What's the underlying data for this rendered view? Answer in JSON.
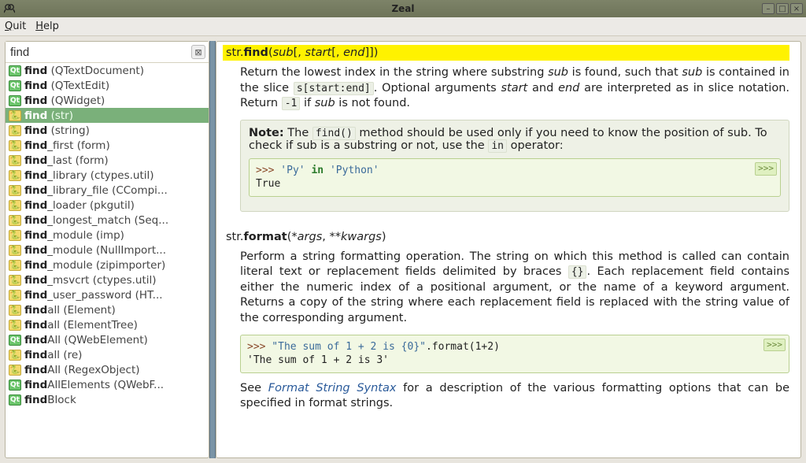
{
  "window": {
    "title": "Zeal"
  },
  "menubar": {
    "quit": "Quit",
    "help": "Help"
  },
  "search": {
    "value": "find"
  },
  "results": [
    {
      "icon": "qt",
      "func": "find",
      "ctx": " (QTextDocument)"
    },
    {
      "icon": "qt",
      "func": "find",
      "ctx": " (QTextEdit)"
    },
    {
      "icon": "qt",
      "func": "find",
      "ctx": " (QWidget)"
    },
    {
      "icon": "py",
      "func": "find",
      "ctx": " (str)",
      "selected": true
    },
    {
      "icon": "py",
      "func": "find",
      "ctx": " (string)"
    },
    {
      "icon": "py",
      "func": "find",
      "ctx": "_first (form)"
    },
    {
      "icon": "py",
      "func": "find",
      "ctx": "_last (form)"
    },
    {
      "icon": "py",
      "func": "find",
      "ctx": "_library (ctypes.util)"
    },
    {
      "icon": "py",
      "func": "find",
      "ctx": "_library_file (CCompi..."
    },
    {
      "icon": "py",
      "func": "find",
      "ctx": "_loader (pkgutil)"
    },
    {
      "icon": "py",
      "func": "find",
      "ctx": "_longest_match (Seq..."
    },
    {
      "icon": "py",
      "func": "find",
      "ctx": "_module (imp)"
    },
    {
      "icon": "py",
      "func": "find",
      "ctx": "_module (NullImport..."
    },
    {
      "icon": "py",
      "func": "find",
      "ctx": "_module (zipimporter)"
    },
    {
      "icon": "py",
      "func": "find",
      "ctx": "_msvcrt (ctypes.util)"
    },
    {
      "icon": "py",
      "func": "find",
      "ctx": "_user_password (HT..."
    },
    {
      "icon": "py",
      "func": "find",
      "ctx": "all (Element)"
    },
    {
      "icon": "py",
      "func": "find",
      "ctx": "all (ElementTree)"
    },
    {
      "icon": "qt",
      "func": "find",
      "ctx": "All (QWebElement)"
    },
    {
      "icon": "py",
      "func": "find",
      "ctx": "all (re)"
    },
    {
      "icon": "py",
      "func": "find",
      "ctx": "All (RegexObject)"
    },
    {
      "icon": "qt",
      "func": "find",
      "ctx": "AllElements (QWebF..."
    },
    {
      "icon": "qt",
      "func": "find",
      "ctx": "Block"
    }
  ],
  "doc": {
    "find": {
      "cls": "str.",
      "name": "find",
      "args_open": "(",
      "a1": "sub",
      "a2_open": "[, ",
      "a2": "start",
      "a3_open": "[, ",
      "a3": "end",
      "args_close": "]])",
      "p1a": "Return the lowest index in the string where substring ",
      "p1b": " is found, such that ",
      "p1c": " is contained in the slice ",
      "slice_code": "s[start:end]",
      "p1d": ". Optional arguments ",
      "p1e": " and ",
      "p1f": " are interpreted as in slice notation. Return ",
      "neg1": "-1",
      "p1g": " if ",
      "p1h": " is not found.",
      "sub": "sub",
      "start": "start",
      "end": "end"
    },
    "note": {
      "label": "Note:",
      "t1": "  The ",
      "code1": "find()",
      "t2": " method should be used only if you need to know the position of ",
      "t3": ". To check if ",
      "t4": " is a substring or not, use the ",
      "code2": "in",
      "t5": " operator:",
      "sub": "sub"
    },
    "code1": {
      "l1_prompt": ">>>",
      "l1_rest": " 'Py' in 'Python'",
      "l2": "True",
      "chev": ">>>"
    },
    "format": {
      "cls": "str.",
      "name": "format",
      "args_open": "(",
      "a1": "*args",
      "sep": ", ",
      "a2": "**kwargs",
      "args_close": ")",
      "p": "Perform a string formatting operation. The string on which this method is called can contain literal text or replacement fields delimited by braces ",
      "braces": "{}",
      "p2": ". Each replacement field contains either the numeric index of a positional argument, or the name of a keyword argument. Returns a copy of the string where each replacement field is replaced with the string value of the corresponding argument."
    },
    "code2": {
      "l1_prompt": ">>>",
      "l1_str": " \"The sum of 1 + 2 is {0}\"",
      "l1_rest": ".format(1+2)",
      "l2": "'The sum of 1 + 2 is 3'",
      "chev": ">>>"
    },
    "see": {
      "t1": "See ",
      "link": "Format String Syntax",
      "t2": " for a description of the various formatting options that can be specified in format strings."
    }
  }
}
